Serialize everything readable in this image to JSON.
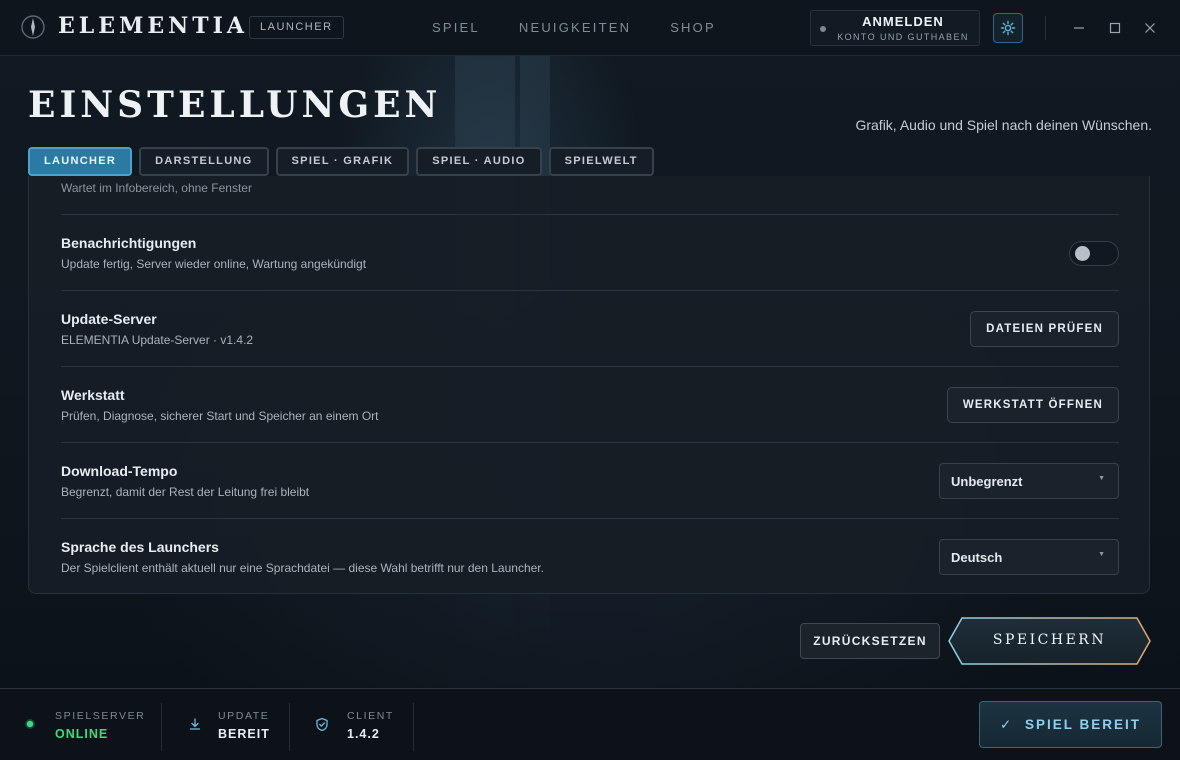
{
  "app": {
    "brand": "ELEMENTIA",
    "brand_tag": "LAUNCHER",
    "nav": [
      "SPIEL",
      "NEUIGKEITEN",
      "SHOP"
    ],
    "login": {
      "title": "ANMELDEN",
      "subtitle": "KONTO UND GUTHABEN"
    }
  },
  "page": {
    "title": "EINSTELLUNGEN",
    "subtitle": "Grafik, Audio und Spiel nach deinen Wünschen.",
    "tabs": [
      {
        "label": "LAUNCHER",
        "active": true
      },
      {
        "label": "DARSTELLUNG",
        "active": false
      },
      {
        "label": "SPIEL · GRAFIK",
        "active": false
      },
      {
        "label": "SPIEL · AUDIO",
        "active": false
      },
      {
        "label": "SPIELWELT",
        "active": false
      }
    ]
  },
  "settings": {
    "partial_top_text": "Wartet im Infobereich, ohne Fenster",
    "notifications": {
      "label": "Benachrichtigungen",
      "desc": "Update fertig, Server wieder online, Wartung angekündigt",
      "enabled": false
    },
    "update_server": {
      "label": "Update-Server",
      "desc": "ELEMENTIA Update-Server · v1.4.2",
      "button": "DATEIEN PRÜFEN"
    },
    "workshop": {
      "label": "Werkstatt",
      "desc": "Prüfen, Diagnose, sicherer Start und Speicher an einem Ort",
      "button": "WERKSTATT ÖFFNEN"
    },
    "download_speed": {
      "label": "Download-Tempo",
      "desc": "Begrenzt, damit der Rest der Leitung frei bleibt",
      "value": "Unbegrenzt"
    },
    "language": {
      "label": "Sprache des Launchers",
      "desc": "Der Spielclient enthält aktuell nur eine Sprachdatei — diese Wahl betrifft nur den Launcher.",
      "value": "Deutsch"
    }
  },
  "actions": {
    "reset": "ZURÜCKSETZEN",
    "save": "SPEICHERN"
  },
  "status": {
    "server": {
      "label": "SPIELSERVER",
      "value": "ONLINE"
    },
    "update": {
      "label": "UPDATE",
      "value": "BEREIT"
    },
    "client": {
      "label": "CLIENT",
      "value": "1.4.2"
    },
    "play_button": "SPIEL BEREIT",
    "play_check": "✓"
  },
  "colors": {
    "accent": "#2a7aa3",
    "online": "#3ddc84",
    "save_border_left": "#8fd0ee",
    "save_border_right": "#e0a96d"
  }
}
